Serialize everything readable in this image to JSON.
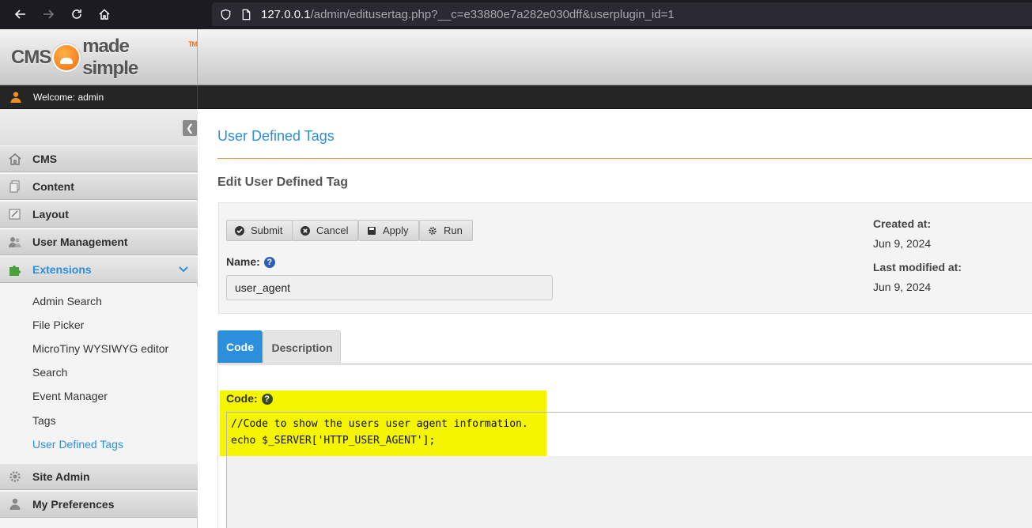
{
  "browser": {
    "url_host": "127.0.0.1",
    "url_path": "/admin/editusertag.php?__c=e33880e7a282e030dff&userplugin_id=1"
  },
  "header": {
    "logo_left": "cms",
    "logo_right": "made simple",
    "logo_tm": "TM",
    "welcome": "Welcome: admin"
  },
  "sidebar": {
    "items": [
      {
        "label": "CMS"
      },
      {
        "label": "Content"
      },
      {
        "label": "Layout"
      },
      {
        "label": "User Management"
      },
      {
        "label": "Extensions"
      },
      {
        "label": "Site Admin"
      },
      {
        "label": "My Preferences"
      }
    ],
    "submenu": [
      {
        "label": "Admin Search"
      },
      {
        "label": "File Picker"
      },
      {
        "label": "MicroTiny WYSIWYG editor"
      },
      {
        "label": "Search"
      },
      {
        "label": "Event Manager"
      },
      {
        "label": "Tags"
      },
      {
        "label": "User Defined Tags"
      }
    ]
  },
  "main": {
    "page_title": "User Defined Tags",
    "section_title": "Edit User Defined Tag",
    "buttons": {
      "submit": "Submit",
      "cancel": "Cancel",
      "apply": "Apply",
      "run": "Run"
    },
    "name_label": "Name:",
    "name_value": "user_agent",
    "help_glyph": "?",
    "created_label": "Created at:",
    "created_value": "Jun 9, 2024",
    "modified_label": "Last modified at:",
    "modified_value": "Jun 9, 2024",
    "tabs": [
      {
        "label": "Code"
      },
      {
        "label": "Description"
      }
    ],
    "code_label": "Code:",
    "code_lines": [
      "//Code to show the users user agent information.",
      "echo $_SERVER['HTTP_USER_AGENT'];"
    ]
  },
  "colors": {
    "accent": "#2b8fdc",
    "rule": "#f29a33",
    "highlight": "#f5f500"
  }
}
